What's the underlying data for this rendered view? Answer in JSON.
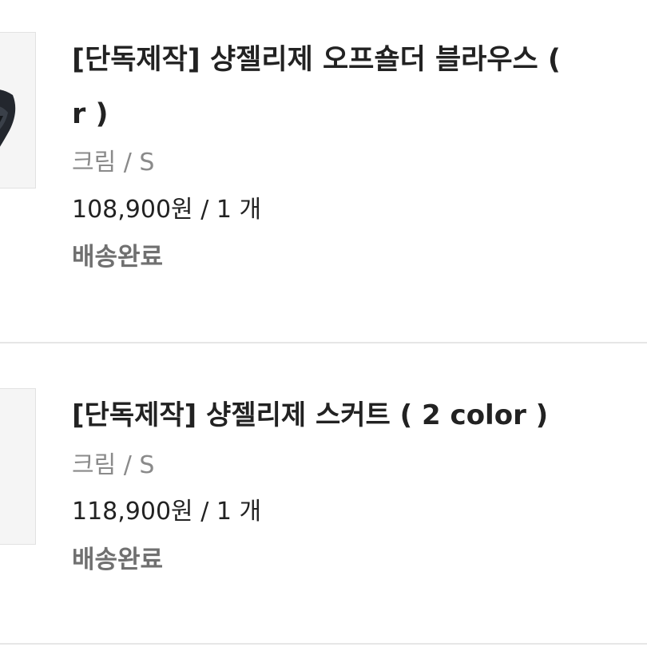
{
  "orders": [
    {
      "title_line1": "[단독제작] 샹젤리제 오프숄더 블라우스 (",
      "title_line2": "r )",
      "option": "크림 / S",
      "price_qty": "108,900원 / 1 개",
      "status": "배송완료"
    },
    {
      "title_line1": "[단독제작] 샹젤리제 스커트 ( 2 color )",
      "option": "크림 / S",
      "price_qty": "118,900원 / 1 개",
      "status": "배송완료"
    }
  ]
}
